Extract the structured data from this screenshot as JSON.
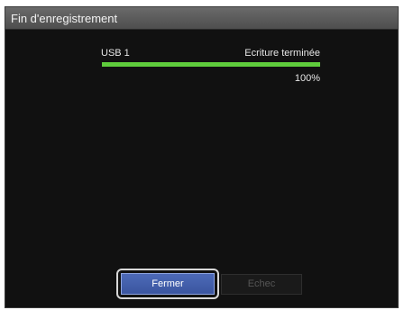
{
  "dialog": {
    "title": "Fin d'enregistrement"
  },
  "device": {
    "name": "USB 1",
    "status": "Ecriture terminée",
    "progress_percent": 100,
    "progress_label": "100%"
  },
  "buttons": {
    "close_label": "Fermer",
    "failure_label": "Echec"
  },
  "colors": {
    "progress": "#5fcc3c",
    "primary_button": "#4d6ab8",
    "background": "#111111",
    "titlebar": "#5a5a5a"
  }
}
